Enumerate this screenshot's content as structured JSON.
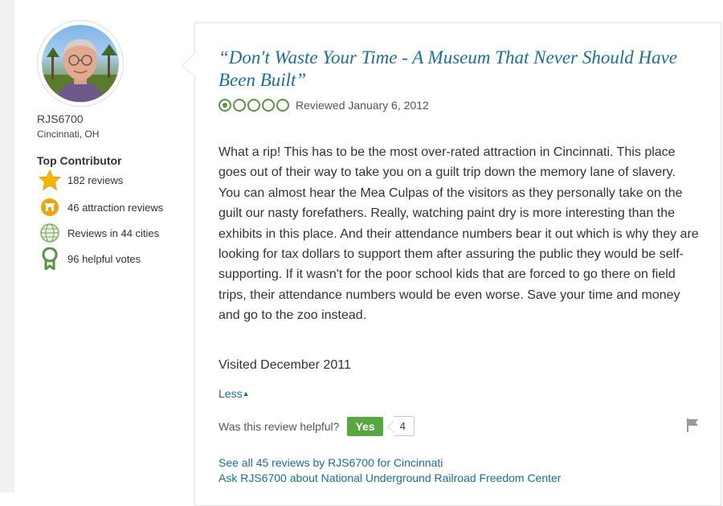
{
  "reviewer": {
    "username": "RJS6700",
    "location": "Cincinnati, OH",
    "badge_title": "Top Contributor",
    "stats": [
      {
        "icon": "star-icon",
        "label": "182 reviews"
      },
      {
        "icon": "attraction-icon",
        "label": "46 attraction reviews"
      },
      {
        "icon": "globe-icon",
        "label": "Reviews in 44 cities"
      },
      {
        "icon": "ribbon-icon",
        "label": "96 helpful votes"
      }
    ]
  },
  "review": {
    "title": "“Don't Waste Your Time - A Museum That Never Should Have Been Built”",
    "rating": 1,
    "rating_max": 5,
    "reviewed_date": "Reviewed January 6, 2012",
    "body": "What a rip! This has to be the most over-rated attraction in Cincinnati. This place goes out of their way to take you on a guilt trip down the memory lane of slavery. You can almost hear the Mea Culpas of the visitors as they personally take on the guilt our nasty forefathers. Really, watching paint dry is more interesting than the exhibits in this place. And their attendance numbers bear it out which is why they are looking for tax dollars to support them after assuring the public they would be self-supporting. If it wasn't for the poor school kids that are forced to go there on field trips, their attendance numbers would be even worse. Save your time and money and go to the zoo instead.",
    "visited": "Visited December 2011",
    "less_label": "Less"
  },
  "helpful": {
    "question": "Was this review helpful?",
    "yes_label": "Yes",
    "count": "4"
  },
  "links": {
    "see_all": "See all 45 reviews by RJS6700 for Cincinnati",
    "ask": "Ask RJS6700 about National Underground Railroad Freedom Center"
  },
  "colors": {
    "accent_link": "#1a6ea0",
    "rating_green": "#589442",
    "yes_button": "#58a83f",
    "badge_orange": "#f0a30a"
  }
}
